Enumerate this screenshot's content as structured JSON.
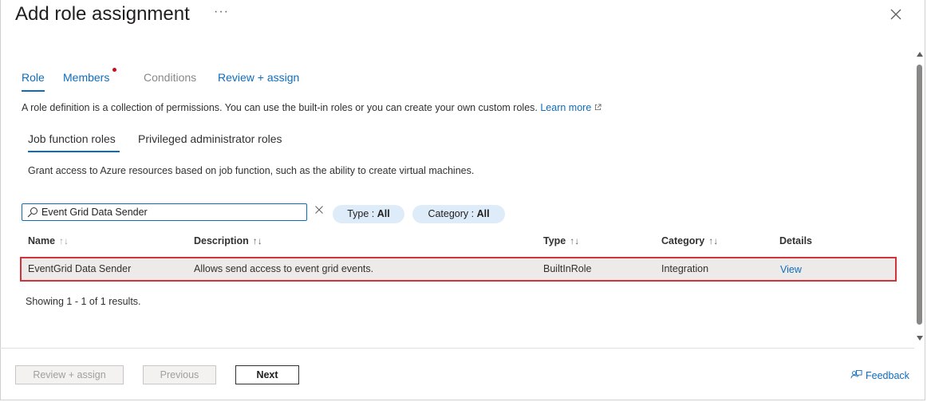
{
  "dialog": {
    "title": "Add role assignment",
    "more": "···"
  },
  "tabs": {
    "role": "Role",
    "members": "Members",
    "conditions": "Conditions",
    "review": "Review + assign"
  },
  "description": {
    "text": "A role definition is a collection of permissions. You can use the built-in roles or you can create your own custom roles. ",
    "link": "Learn more"
  },
  "subtabs": {
    "job": "Job function roles",
    "privileged": "Privileged administrator roles"
  },
  "grant_text": "Grant access to Azure resources based on job function, such as the ability to create virtual machines.",
  "search": {
    "value": "Event Grid Data Sender"
  },
  "filters": {
    "type_label": "Type : ",
    "type_value": "All",
    "category_label": "Category : ",
    "category_value": "All"
  },
  "table": {
    "headers": {
      "name": "Name",
      "description": "Description",
      "type": "Type",
      "category": "Category",
      "details": "Details"
    },
    "rows": [
      {
        "name": "EventGrid Data Sender",
        "description": "Allows send access to event grid events.",
        "type": "BuiltInRole",
        "category": "Integration",
        "details": "View"
      }
    ],
    "results": "Showing 1 - 1 of 1 results."
  },
  "footer": {
    "review_button": "Review + assign",
    "previous_button": "Previous",
    "next_button": "Next",
    "feedback": "Feedback"
  },
  "colors": {
    "accent": "#0f6cbd",
    "highlight_border": "#d13438",
    "pill_bg": "#deecf9"
  }
}
